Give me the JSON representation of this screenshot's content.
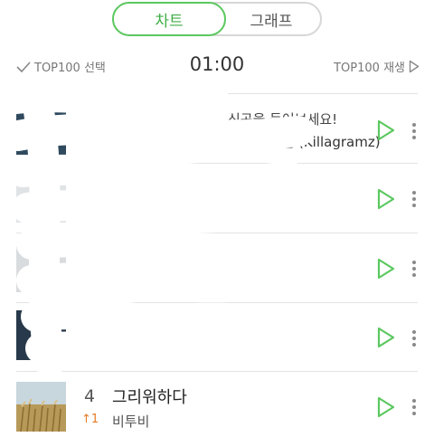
{
  "tabs": [
    {
      "label": "차트",
      "active": true
    },
    {
      "label": "그래프",
      "active": false
    }
  ],
  "controls": {
    "select_label": "TOP100 선택",
    "timer": "01:00",
    "play_all_label": "TOP100 재생"
  },
  "banner": {
    "text": "신곡을 들어보세요!",
    "artist": "킬라그램 (Killagramz)"
  },
  "chart": {
    "visible_song": {
      "rank": "4",
      "change": "↑1",
      "title": "그리워하다",
      "artist": "비투비"
    }
  },
  "colors": {
    "accent_green": "#5bc85f",
    "change_orange": "#e47b27"
  }
}
